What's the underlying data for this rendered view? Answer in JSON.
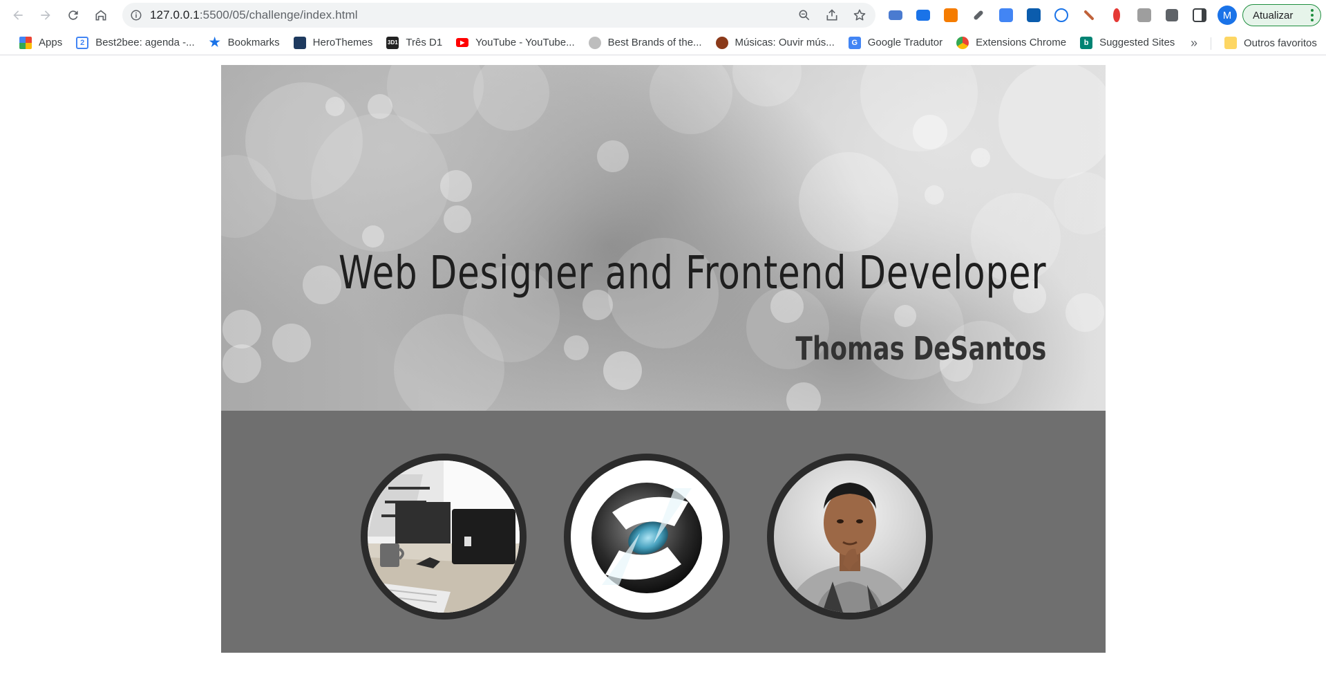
{
  "browser": {
    "url_host": "127.0.0.1",
    "url_path": ":5500/05/challenge/index.html",
    "avatar_letter": "M",
    "update_label": "Atualizar"
  },
  "bookmarks": [
    {
      "label": "Apps",
      "icon": "apps-grid-icon",
      "color": "#ea4335"
    },
    {
      "label": "Best2bee: agenda -...",
      "icon": "calendar-icon",
      "color": "#4285f4"
    },
    {
      "label": "Bookmarks",
      "icon": "star-icon",
      "color": "#1a73e8"
    },
    {
      "label": "HeroThemes",
      "icon": "herothemes-icon",
      "color": "#1e3a5f"
    },
    {
      "label": "Três D1",
      "icon": "tres-d1-icon",
      "color": "#222222"
    },
    {
      "label": "YouTube - YouTube...",
      "icon": "youtube-icon",
      "color": "#ff0000"
    },
    {
      "label": "Best Brands of the...",
      "icon": "globe-icon",
      "color": "#888888"
    },
    {
      "label": "Músicas: Ouvir mús...",
      "icon": "music-icon",
      "color": "#8b3a1a"
    },
    {
      "label": "Google Tradutor",
      "icon": "translate-icon",
      "color": "#4285f4"
    },
    {
      "label": "Extensions Chrome",
      "icon": "chrome-icon",
      "color": "#34a853"
    },
    {
      "label": "Suggested Sites",
      "icon": "bing-icon",
      "color": "#008373"
    }
  ],
  "bookmarks_more": "»",
  "other_bookmarks": "Outros favoritos",
  "hero": {
    "title": "Web Designer and Frontend Developer",
    "name": "Thomas DeSantos"
  },
  "gallery": [
    {
      "subject": "workspace-photo"
    },
    {
      "subject": "s-logo"
    },
    {
      "subject": "portrait-photo"
    }
  ],
  "colors": {
    "gallery_bg": "#6f6f6f",
    "circle_border": "#2b2b2b"
  }
}
